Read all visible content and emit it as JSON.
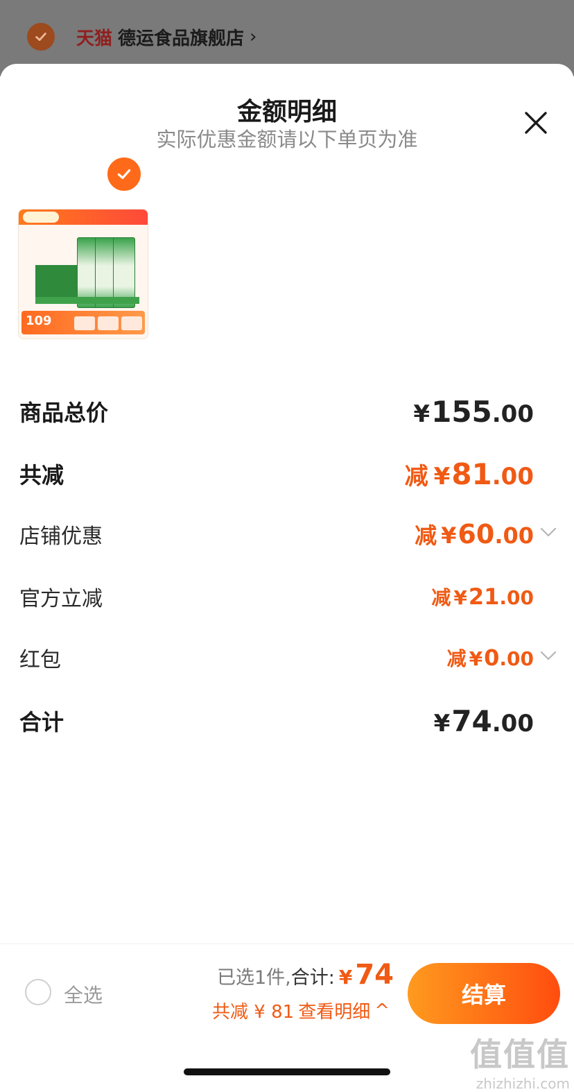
{
  "store": {
    "brand": "天猫",
    "name": "德运食品旗舰店",
    "chevron": "›"
  },
  "sheet": {
    "title": "金额明细",
    "subtitle": "实际优惠金额请以下单页为准"
  },
  "product": {
    "thumb_price": "109"
  },
  "rows": {
    "total_price": {
      "label": "商品总价",
      "currency": "¥",
      "int": "155",
      "dec": ".00"
    },
    "total_reduce": {
      "label": "共减",
      "prefix": "减",
      "currency": "¥",
      "int": "81",
      "dec": ".00"
    },
    "store_discount": {
      "label": "店铺优惠",
      "prefix": "减",
      "currency": "¥",
      "int": "60",
      "dec": ".00"
    },
    "official_reduce": {
      "label": "官方立减",
      "prefix": "减",
      "currency": "¥",
      "int": "21",
      "dec": ".00"
    },
    "red_packet": {
      "label": "红包",
      "prefix": "减",
      "currency": "¥",
      "int": "0",
      "dec": ".00"
    },
    "sum": {
      "label": "合计",
      "currency": "¥",
      "int": "74",
      "dec": ".00"
    }
  },
  "bottom_bar": {
    "select_all": "全选",
    "selected_text": "已选1件,",
    "total_label": "合计:",
    "currency": "¥",
    "total": "74",
    "reduce_text": "共减 ¥ 81",
    "detail_link": "查看明细",
    "detail_chevron": "^",
    "checkout": "结算"
  },
  "watermark": {
    "big": "值值值",
    "small": "zhizhizhi.com"
  },
  "colors": {
    "accent": "#f05a14",
    "checkout_start": "#ff9a1e",
    "checkout_end": "#ff4d0f",
    "backdrop": "#7a7a7a"
  }
}
